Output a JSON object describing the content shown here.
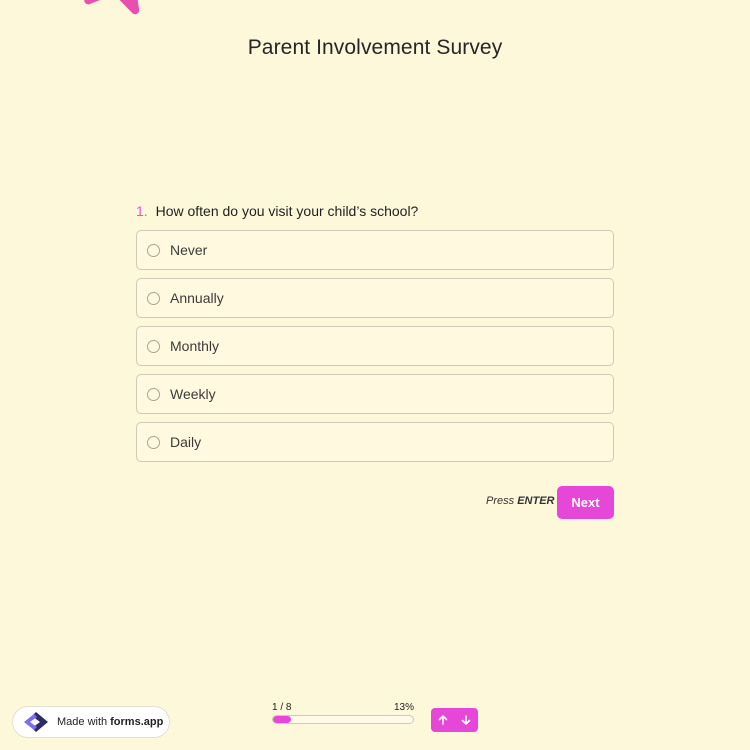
{
  "survey": {
    "title": "Parent Involvement Survey"
  },
  "question": {
    "number": "1.",
    "text": "How often do you visit your child’s school?",
    "options": [
      {
        "label": "Never",
        "selected": false
      },
      {
        "label": "Annually",
        "selected": false
      },
      {
        "label": "Monthly",
        "selected": false
      },
      {
        "label": "Weekly",
        "selected": false
      },
      {
        "label": "Daily",
        "selected": false
      }
    ]
  },
  "actions": {
    "press_label": "Press",
    "enter_label": "ENTER",
    "next_label": "Next"
  },
  "progress": {
    "page_label": "1 / 8",
    "percent_label": "13%",
    "percent_value": 13
  },
  "badge": {
    "made_with": "Made with",
    "brand": "forms.app"
  },
  "icons": {
    "decoration": "starfish-icon",
    "logo": "forms-app-logo-icon",
    "up": "arrow-up-icon",
    "down": "arrow-down-icon"
  },
  "colors": {
    "background": "#fef8da",
    "accent": "#e647d8",
    "question_number": "#e255d4"
  }
}
